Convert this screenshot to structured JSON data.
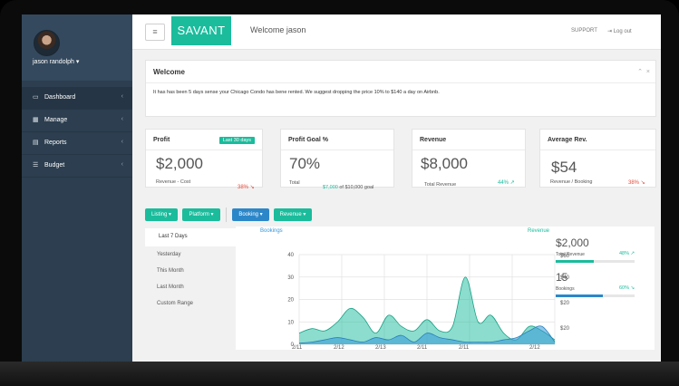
{
  "sidebar": {
    "user_name": "jason randolph ▾",
    "items": [
      {
        "label": "Dashboard",
        "icon": "monitor-icon",
        "active": true
      },
      {
        "label": "Manage",
        "icon": "calendar-icon",
        "active": false
      },
      {
        "label": "Reports",
        "icon": "table-icon",
        "active": false
      },
      {
        "label": "Budget",
        "icon": "list-icon",
        "active": false
      }
    ]
  },
  "header": {
    "brand": "SAVANT",
    "welcome": "Welcome jason",
    "support": "SUPPORT",
    "logout": "Log out"
  },
  "welcome_panel": {
    "title": "Welcome",
    "message": "It has has been 5 days sense your Chicago Condo has bene rented. We suggest dropping the price 10% to $140 a day on Airbnb."
  },
  "cards": {
    "profit": {
      "title": "Profit",
      "badge": "Last 30 days",
      "value": "$2,000",
      "sub": "Revenue - Cost",
      "pct": "38% ↘"
    },
    "goal": {
      "title": "Profit Goal %",
      "value": "70%",
      "sub_label": "Total",
      "sub_amount": "$7,000",
      "sub_rest": "of $10,000 goal"
    },
    "revenue": {
      "title": "Revenue",
      "value": "$8,000",
      "sub": "Total Revenue",
      "pct": "44% ↗"
    },
    "avg": {
      "title": "Average Rev.",
      "value": "$54",
      "sub": "Revenue / Booking",
      "pct": "38% ↘"
    }
  },
  "filters": {
    "listing": "Listing ▾",
    "platform": "Platform ▾",
    "booking": "Booking ▾",
    "revenue": "Revenue ▾"
  },
  "ranges": [
    "Last 7 Days",
    "Yesterday",
    "This Month",
    "Last Month",
    "Custom Range"
  ],
  "colors": {
    "teal": "#1abc9c",
    "blue": "#3498db",
    "red": "#e74c3c",
    "sidebar": "#2c3e4f"
  },
  "stats": {
    "revenue_total": {
      "value": "$2,000",
      "label": "Total Revenue",
      "pct": "48% ↗",
      "fill": 0.48
    },
    "bookings": {
      "value": "15",
      "label": "Bookings",
      "pct": "60% ↘",
      "fill": 0.6
    }
  },
  "chart_data": {
    "type": "area",
    "left_axis": {
      "label": "Bookings",
      "ticks": [
        0,
        10,
        20,
        30,
        40
      ],
      "range": [
        0,
        40
      ]
    },
    "right_axis": {
      "label": "Revenue",
      "ticks": [
        "$20",
        "$20",
        "$40",
        "$60"
      ]
    },
    "x_labels": [
      "2/11",
      "2/12",
      "2/13",
      "2/11",
      "2/11",
      "2/12"
    ],
    "series": [
      {
        "name": "Revenue",
        "values": [
          5,
          7,
          6,
          10,
          16,
          12,
          5,
          13,
          8,
          6,
          11,
          6,
          8,
          30,
          10,
          13,
          5,
          2,
          8,
          6,
          2
        ]
      },
      {
        "name": "Bookings",
        "values": [
          0.5,
          1,
          2,
          3,
          2,
          1,
          3,
          2,
          4,
          1,
          5,
          3,
          2,
          1,
          1,
          1,
          2,
          3,
          6,
          8,
          1
        ]
      }
    ]
  }
}
